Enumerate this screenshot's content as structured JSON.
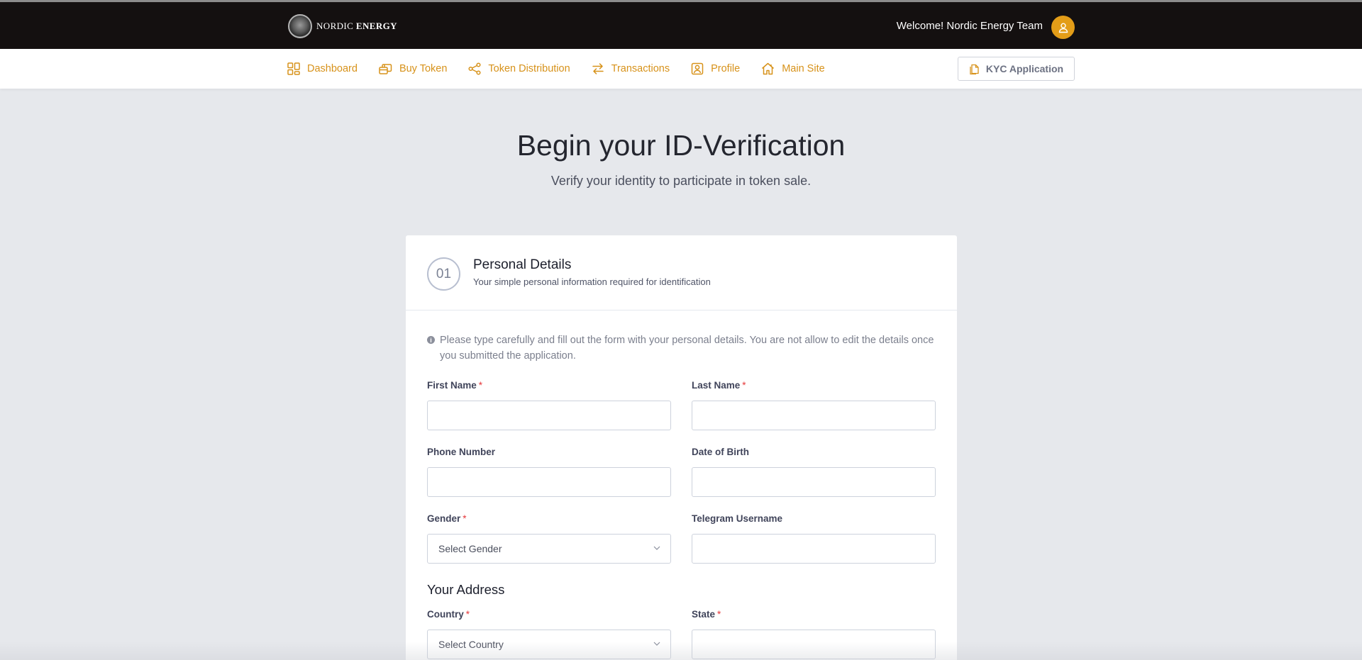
{
  "header": {
    "brand_light": "NORDIC",
    "brand_bold": "ENERGY",
    "welcome": "Welcome! Nordic Energy Team",
    "avatar_icon": "user-icon"
  },
  "nav": {
    "items": [
      {
        "label": "Dashboard",
        "icon": "grid-icon"
      },
      {
        "label": "Buy Token",
        "icon": "coins-icon"
      },
      {
        "label": "Token Distribution",
        "icon": "distribution-icon"
      },
      {
        "label": "Transactions",
        "icon": "swap-icon"
      },
      {
        "label": "Profile",
        "icon": "profile-icon"
      },
      {
        "label": "Main Site",
        "icon": "home-icon"
      }
    ],
    "kyc_button": "KYC Application"
  },
  "hero": {
    "title": "Begin your ID-Verification",
    "subtitle": "Verify your identity to participate in token sale."
  },
  "card": {
    "step_number": "01",
    "title": "Personal Details",
    "subtitle": "Your simple personal information required for identification",
    "notice": "Please type carefully and fill out the form with your personal details. You are not allow to edit the details once you submitted the application.",
    "required_marker": "*",
    "fields": {
      "first_name": {
        "label": "First Name",
        "value": ""
      },
      "last_name": {
        "label": "Last Name",
        "value": ""
      },
      "phone": {
        "label": "Phone Number",
        "value": ""
      },
      "dob": {
        "label": "Date of Birth",
        "value": ""
      },
      "gender": {
        "label": "Gender",
        "selected": "Select Gender"
      },
      "telegram": {
        "label": "Telegram Username",
        "value": ""
      },
      "country": {
        "label": "Country",
        "selected": "Select Country"
      },
      "state": {
        "label": "State",
        "value": ""
      }
    },
    "address_title": "Your Address"
  },
  "colors": {
    "accent": "#d7921a",
    "topbar": "#141010",
    "required": "#e5373a"
  }
}
